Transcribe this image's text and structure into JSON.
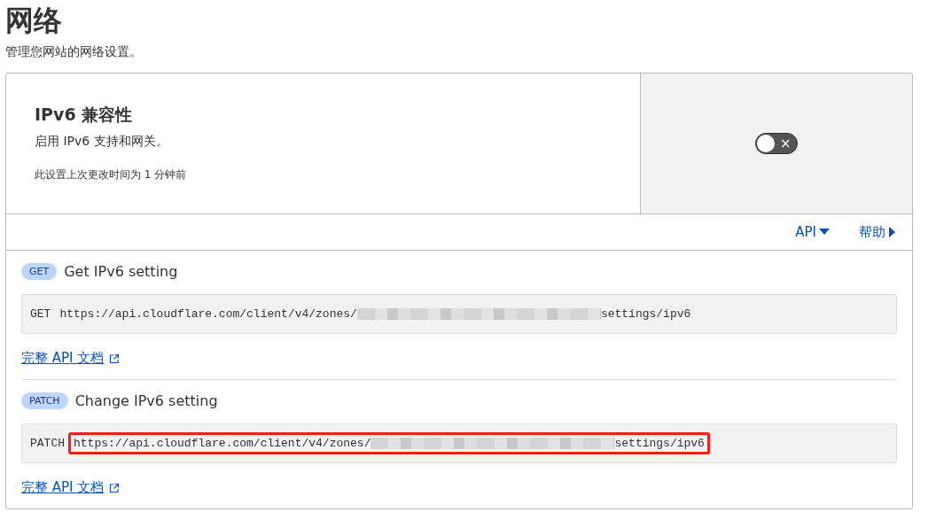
{
  "page": {
    "title": "网络",
    "subtitle": "管理您网站的网络设置。"
  },
  "setting": {
    "title": "IPv6 兼容性",
    "description": "启用 IPv6 支持和网关。",
    "last_changed": "此设置上次更改时间为 1 分钟前",
    "toggle": {
      "on": false,
      "icon": "×"
    }
  },
  "links": [
    {
      "label": "API",
      "expanded": true
    },
    {
      "label": "帮助",
      "expanded": false
    }
  ],
  "endpoints": [
    {
      "method": "GET",
      "title": "Get IPv6 setting",
      "request_method": "GET",
      "url_start": "https://api.cloudflare.com/client/v4/zones/",
      "url_end": "settings/ipv6",
      "highlighted": false,
      "docs_link": "完整 API 文档"
    },
    {
      "method": "PATCH",
      "title": "Change IPv6 setting",
      "request_method": "PATCH",
      "url_start": "https://api.cloudflare.com/client/v4/zones/",
      "url_end": "settings/ipv6",
      "highlighted": true,
      "docs_link": "完整 API 文档"
    }
  ]
}
